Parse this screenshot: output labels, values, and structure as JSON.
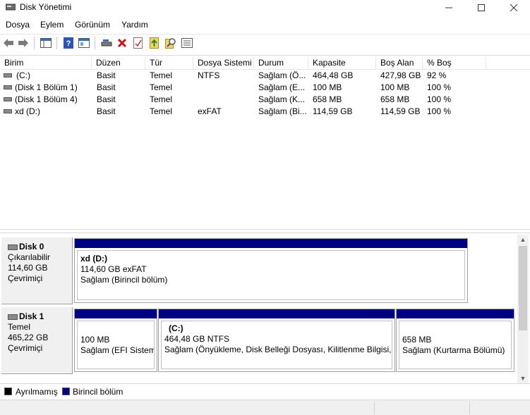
{
  "window": {
    "title": "Disk Yönetimi"
  },
  "menu": [
    "Dosya",
    "Eylem",
    "Görünüm",
    "Yardım"
  ],
  "icons": {
    "app": "disk-management-icon",
    "back": "back-arrow-icon",
    "forward": "forward-arrow-icon",
    "console": "console-tree-icon",
    "help": "help-icon",
    "properties": "properties-icon",
    "connect": "connect-drive-icon",
    "delete": "delete-icon",
    "check": "check-icon",
    "export": "export-icon",
    "search": "search-icon",
    "view": "view-icon"
  },
  "volumes": {
    "columns": [
      "Birim",
      "Düzen",
      "Tür",
      "Dosya Sistemi",
      "Durum",
      "Kapasite",
      "Boş Alan",
      "% Boş"
    ],
    "rows": [
      [
        "(C:)",
        "Basit",
        "Temel",
        "NTFS",
        "Sağlam (Ö...",
        "464,48 GB",
        "427,98 GB",
        "92 %"
      ],
      [
        "(Disk 1 Bölüm 1)",
        "Basit",
        "Temel",
        "",
        "Sağlam (E...",
        "100 MB",
        "100 MB",
        "100 %"
      ],
      [
        "(Disk 1 Bölüm 4)",
        "Basit",
        "Temel",
        "",
        "Sağlam (K...",
        "658 MB",
        "658 MB",
        "100 %"
      ],
      [
        "xd (D:)",
        "Basit",
        "Temel",
        "exFAT",
        "Sağlam (Bi...",
        "114,59 GB",
        "114,59 GB",
        "100 %"
      ]
    ]
  },
  "disks": [
    {
      "name": "Disk 0",
      "type": "Çıkarılabilir",
      "size": "114,60 GB",
      "status": "Çevrimiçi",
      "partitions": [
        {
          "title": "xd  (D:)",
          "size": "114,60 GB exFAT",
          "status": "Sağlam (Birincil bölüm)"
        }
      ]
    },
    {
      "name": "Disk 1",
      "type": "Temel",
      "size": "465,22 GB",
      "status": "Çevrimiçi",
      "partitions": [
        {
          "title": "",
          "size": "100 MB",
          "status": "Sağlam (EFI Sistem"
        },
        {
          "title": "(C:)",
          "size": "464,48 GB NTFS",
          "status": "Sağlam (Önyükleme, Disk Belleği Dosyası, Kilitlenme Bilgisi, T"
        },
        {
          "title": "",
          "size": "658 MB",
          "status": "Sağlam (Kurtarma Bölümü)"
        }
      ]
    }
  ],
  "legend": [
    {
      "label": "Ayrılmamış",
      "color": "#000000"
    },
    {
      "label": "Birincil bölüm",
      "color": "#000082"
    }
  ]
}
